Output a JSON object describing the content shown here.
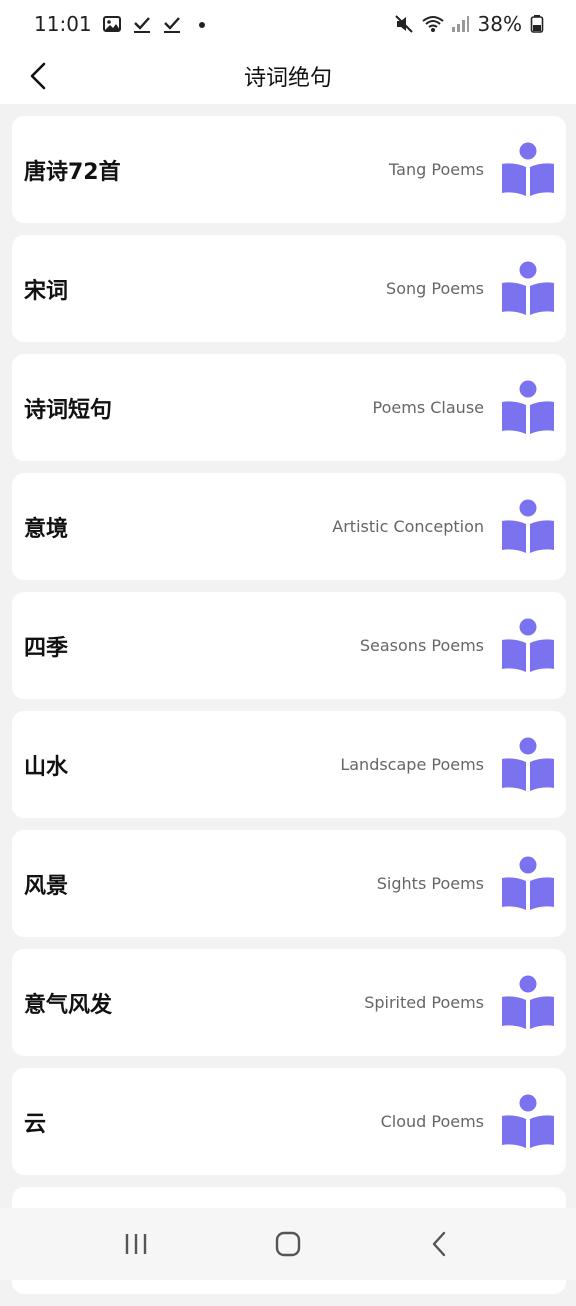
{
  "status_bar": {
    "time": "11:01",
    "battery": "38%",
    "left_icons": [
      "image-icon",
      "check-icon",
      "check-icon",
      "dot-icon"
    ],
    "right_icons": [
      "mute-icon",
      "wifi-icon",
      "signal-icon",
      "battery-icon"
    ]
  },
  "header": {
    "title": "诗词绝句",
    "back_icon": "chevron-left-icon"
  },
  "categories": [
    {
      "title": "唐诗72首",
      "subtitle": "Tang Poems"
    },
    {
      "title": "宋词",
      "subtitle": "Song Poems"
    },
    {
      "title": "诗词短句",
      "subtitle": "Poems Clause"
    },
    {
      "title": "意境",
      "subtitle": "Artistic Conception"
    },
    {
      "title": "四季",
      "subtitle": "Seasons Poems"
    },
    {
      "title": "山水",
      "subtitle": "Landscape Poems"
    },
    {
      "title": "风景",
      "subtitle": "Sights Poems"
    },
    {
      "title": "意气风发",
      "subtitle": "Spirited Poems"
    },
    {
      "title": "云",
      "subtitle": "Cloud Poems"
    }
  ],
  "category_icon": "reader-book-icon",
  "colors": {
    "accent": "#7b72f0",
    "card_bg": "#ffffff",
    "page_bg": "#f2f2f2"
  },
  "navigation_bar": {
    "icons": [
      "recent-apps-icon",
      "home-icon",
      "back-icon"
    ]
  }
}
